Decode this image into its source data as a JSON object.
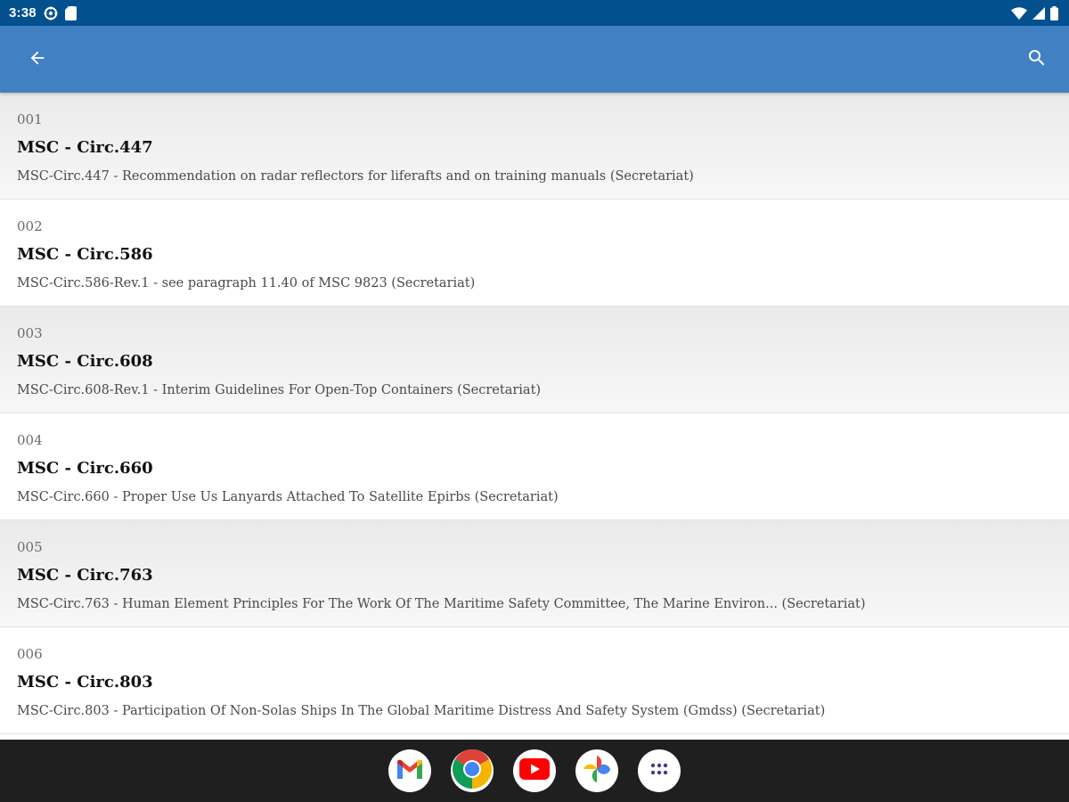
{
  "status_bar": {
    "time": "3:38",
    "left_icons": [
      "settings-icon",
      "sd-card-icon"
    ],
    "right_icons": [
      "wifi-icon",
      "cell-signal-icon",
      "battery-icon"
    ]
  },
  "app_bar": {
    "background": "#4080c3",
    "back_icon": "arrow-back-icon",
    "search_icon": "search-icon"
  },
  "list": {
    "items": [
      {
        "number": "001",
        "title": "MSC - Circ.447",
        "description": "MSC-Circ.447 - Recommendation on radar reflectors for liferafts and on training manuals (Secretariat)"
      },
      {
        "number": "002",
        "title": "MSC - Circ.586",
        "description": "MSC-Circ.586-Rev.1 - see paragraph 11.40 of MSC 9823 (Secretariat)"
      },
      {
        "number": "003",
        "title": "MSC - Circ.608",
        "description": "MSC-Circ.608-Rev.1 - Interim Guidelines For Open-Top Containers (Secretariat)"
      },
      {
        "number": "004",
        "title": "MSC - Circ.660",
        "description": "MSC-Circ.660 - Proper Use Us Lanyards Attached To Satellite Epirbs (Secretariat)"
      },
      {
        "number": "005",
        "title": "MSC - Circ.763",
        "description": "MSC-Circ.763 - Human Element Principles For The Work Of The Maritime Safety Committee, The Marine Environ... (Secretariat)"
      },
      {
        "number": "006",
        "title": "MSC - Circ.803",
        "description": "MSC-Circ.803 - Participation Of Non-Solas Ships In The Global Maritime Distress And Safety System (Gmdss) (Secretariat)"
      }
    ]
  },
  "dock": {
    "apps": [
      "gmail-icon",
      "chrome-icon",
      "youtube-icon",
      "photos-icon",
      "app-drawer-icon"
    ]
  }
}
